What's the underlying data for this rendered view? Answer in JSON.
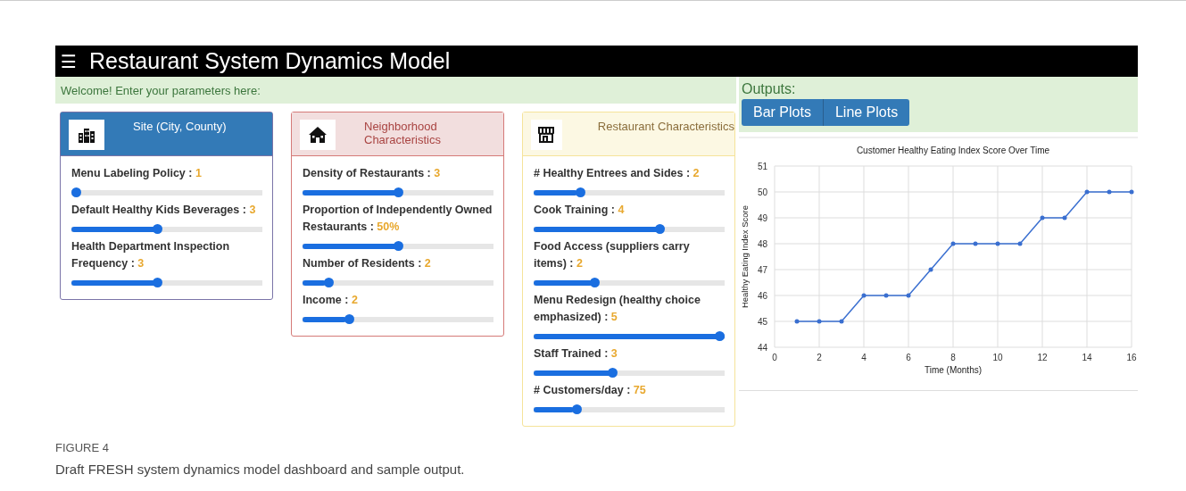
{
  "header": {
    "menu_glyph": "☰",
    "title": "Restaurant System Dynamics Model"
  },
  "welcome": "Welcome! Enter your parameters here:",
  "panels": [
    {
      "kind": "site",
      "title": "Site (City, County)",
      "parameters": [
        {
          "label": "Menu Labeling Policy :",
          "value": "1",
          "level": 0.0
        },
        {
          "label": "Default Healthy Kids Beverages :",
          "value": "3",
          "level": 0.45
        },
        {
          "label": "Health Department Inspection Frequency :",
          "value": "3",
          "level": 0.45
        }
      ]
    },
    {
      "kind": "neighborhood",
      "title": "Neighborhood Characteristics",
      "parameters": [
        {
          "label": "Density of Restaurants :",
          "value": "3",
          "level": 0.5
        },
        {
          "label": "Proportion of Independently Owned Restaurants :",
          "value": "50%",
          "level": 0.5
        },
        {
          "label": "Number of Residents :",
          "value": "2",
          "level": 0.12
        },
        {
          "label": "Income :",
          "value": "2",
          "level": 0.23
        }
      ]
    },
    {
      "kind": "restaurant",
      "title": "Restaurant Characteristics",
      "parameters": [
        {
          "label": "# Healthy Entrees and Sides :",
          "value": "2",
          "level": 0.23
        },
        {
          "label": "Cook Training :",
          "value": "4",
          "level": 0.67
        },
        {
          "label": "Food Access (suppliers carry items) :",
          "value": "2",
          "level": 0.31
        },
        {
          "label": "Menu Redesign (healthy choice emphasized) :",
          "value": "5",
          "level": 1.0
        },
        {
          "label": "Staff Trained :",
          "value": "3",
          "level": 0.41
        },
        {
          "label": "# Customers/day :",
          "value": "75",
          "level": 0.21
        }
      ]
    }
  ],
  "outputs": {
    "heading": "Outputs:",
    "tabs": [
      "Bar Plots",
      "Line Plots"
    ],
    "chart_data": {
      "type": "line",
      "title": "Customer Healthy Eating Index Score Over Time",
      "xlabel": "Time (Months)",
      "ylabel": "Healthy Eating Index Score",
      "x": [
        1,
        2,
        3,
        4,
        5,
        6,
        7,
        8,
        9,
        10,
        11,
        12,
        13,
        14,
        15,
        16
      ],
      "grid": true,
      "series": [
        {
          "color": "#3a6fd0",
          "values": [
            45,
            45,
            45,
            46,
            46,
            46,
            47,
            48,
            48,
            48,
            48,
            49,
            49,
            50,
            50,
            50
          ]
        }
      ],
      "xlim": [
        0,
        16
      ],
      "ylim": [
        44,
        51
      ],
      "xticks": [
        0,
        2,
        4,
        6,
        8,
        10,
        12,
        14,
        16
      ],
      "yticks": [
        44,
        45,
        46,
        47,
        48,
        49,
        50,
        51
      ]
    }
  },
  "caption": {
    "label": "FIGURE 4",
    "text": "Draft FRESH system dynamics model dashboard and sample output."
  }
}
